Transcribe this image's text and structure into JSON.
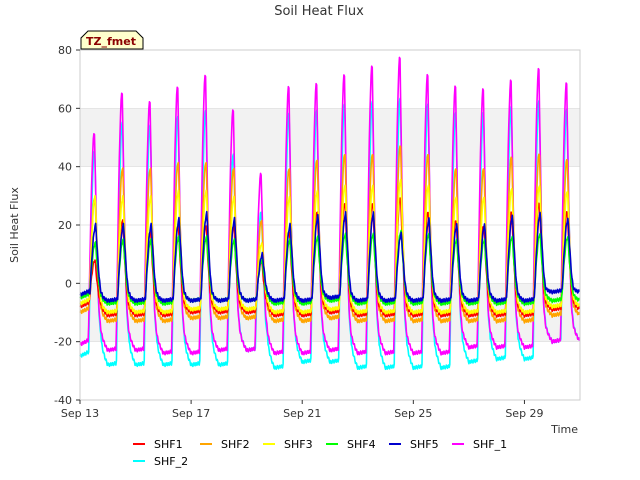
{
  "chart_data": {
    "type": "line",
    "title": "Soil Heat Flux",
    "xlabel": "Time",
    "ylabel": "Soil Heat Flux",
    "badge": "TZ_fmet",
    "ylim": [
      -40,
      80
    ],
    "xlim": [
      "Sep 13",
      "Oct 1"
    ],
    "xlim_days": [
      13.0,
      31.0
    ],
    "y_ticks": [
      -40,
      -20,
      0,
      20,
      40,
      60,
      80
    ],
    "x_ticks": [
      {
        "label": "Sep 13",
        "day": 13
      },
      {
        "label": "Sep 17",
        "day": 17
      },
      {
        "label": "Sep 21",
        "day": 21
      },
      {
        "label": "Sep 25",
        "day": 25
      },
      {
        "label": "Sep 29",
        "day": 29
      }
    ],
    "background_bands": [
      [
        -20,
        0
      ],
      [
        40,
        60
      ]
    ],
    "grid": true,
    "legend_position": "bottom",
    "days": [
      "Sep 13",
      "Sep 14",
      "Sep 15",
      "Sep 16",
      "Sep 17",
      "Sep 18",
      "Sep 19",
      "Sep 20",
      "Sep 21",
      "Sep 22",
      "Sep 23",
      "Sep 24",
      "Sep 25",
      "Sep 26",
      "Sep 27",
      "Sep 28",
      "Sep 29",
      "Sep 30"
    ],
    "series": [
      {
        "name": "SHF1",
        "color": "#ff0000",
        "daily_max": [
          8,
          22,
          18,
          20,
          20,
          20,
          8,
          18,
          25,
          28,
          28,
          30,
          25,
          22,
          20,
          25,
          28,
          25
        ],
        "daily_min": [
          -8,
          -11,
          -11,
          -11,
          -10,
          -10,
          -10,
          -11,
          -11,
          -10,
          -11,
          -11,
          -11,
          -11,
          -11,
          -11,
          -11,
          -9
        ]
      },
      {
        "name": "SHF2",
        "color": "#ffa500",
        "daily_max": [
          30,
          40,
          40,
          42,
          42,
          40,
          22,
          40,
          43,
          45,
          45,
          48,
          45,
          40,
          40,
          44,
          45,
          43
        ],
        "daily_min": [
          -10,
          -13,
          -13,
          -13,
          -12,
          -12,
          -12,
          -13,
          -13,
          -12,
          -13,
          -13,
          -13,
          -13,
          -13,
          -13,
          -13,
          -11
        ]
      },
      {
        "name": "SHF3",
        "color": "#ffff00",
        "daily_max": [
          30,
          30,
          30,
          32,
          32,
          30,
          14,
          30,
          32,
          34,
          34,
          36,
          34,
          30,
          30,
          33,
          34,
          32
        ],
        "daily_min": [
          -7,
          -10,
          -10,
          -10,
          -9,
          -9,
          -9,
          -10,
          -10,
          -9,
          -10,
          -10,
          -10,
          -10,
          -10,
          -10,
          -10,
          -8
        ]
      },
      {
        "name": "SHF4",
        "color": "#00ff00",
        "daily_max": [
          14,
          15,
          15,
          16,
          16,
          15,
          8,
          15,
          16,
          17,
          17,
          18,
          17,
          15,
          15,
          16,
          17,
          16
        ],
        "daily_min": [
          -5,
          -7,
          -7,
          -7,
          -6,
          -6,
          -6,
          -7,
          -7,
          -6,
          -7,
          -7,
          -7,
          -7,
          -7,
          -7,
          -7,
          -6
        ]
      },
      {
        "name": "SHF5",
        "color": "#0000cd",
        "daily_max": [
          20,
          20,
          20,
          22,
          24,
          22,
          10,
          20,
          23,
          24,
          24,
          17,
          22,
          20,
          20,
          23,
          24,
          22
        ],
        "daily_min": [
          -4,
          -6,
          -6,
          -6,
          -6,
          -6,
          -6,
          -6,
          -6,
          -5,
          -6,
          -6,
          -6,
          -6,
          -6,
          -6,
          -6,
          -3
        ]
      },
      {
        "name": "SHF_1",
        "color": "#ff00ff",
        "daily_max": [
          52,
          66,
          63,
          68,
          72,
          60,
          38,
          68,
          69,
          72,
          75,
          78,
          72,
          68,
          67,
          70,
          74,
          69
        ],
        "daily_min": [
          -21,
          -23,
          -23,
          -24,
          -24,
          -23,
          -23,
          -24,
          -24,
          -23,
          -24,
          -24,
          -24,
          -24,
          -22,
          -22,
          -22,
          -20
        ]
      },
      {
        "name": "SHF_2",
        "color": "#00ffff",
        "daily_max": [
          46,
          56,
          55,
          58,
          60,
          45,
          25,
          59,
          60,
          62,
          63,
          64,
          62,
          59,
          59,
          61,
          63,
          60
        ],
        "daily_min": [
          -25,
          -28,
          -28,
          -28,
          -28,
          -28,
          -23,
          -29,
          -27,
          -27,
          -29,
          -29,
          -29,
          -29,
          -27,
          -26,
          -26,
          -20
        ]
      }
    ]
  }
}
